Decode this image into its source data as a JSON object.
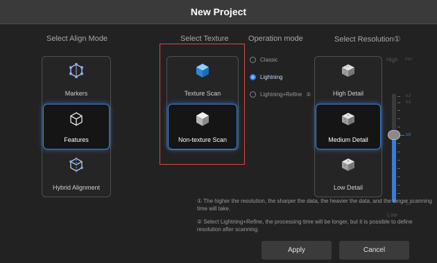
{
  "window": {
    "title": "New Project"
  },
  "align_mode": {
    "heading": "Select Align Mode",
    "options": [
      {
        "label": "Markers",
        "selected": false,
        "icon": "markers-icon"
      },
      {
        "label": "Features",
        "selected": true,
        "icon": "features-cube-icon"
      },
      {
        "label": "Hybrid Alignment",
        "selected": false,
        "icon": "hybrid-alignment-icon"
      }
    ]
  },
  "texture": {
    "heading": "Select Texture",
    "options": [
      {
        "label": "Texture Scan",
        "selected": false,
        "icon": "texture-cube-icon"
      },
      {
        "label": "Non-texture Scan",
        "selected": true,
        "icon": "non-texture-cube-icon"
      }
    ]
  },
  "operation_mode": {
    "heading": "Operation mode",
    "options": [
      {
        "label": "Classic",
        "selected": false
      },
      {
        "label": "Lightning",
        "selected": true
      },
      {
        "label": "Lightning+Refine",
        "selected": false,
        "marker": "②"
      }
    ]
  },
  "resolution": {
    "heading": "Select Resolution",
    "heading_marker": "①",
    "options": [
      {
        "label": "High Detail",
        "selected": false,
        "icon": "high-detail-icon"
      },
      {
        "label": "Medium Detail",
        "selected": true,
        "icon": "medium-detail-icon"
      },
      {
        "label": "Low Detail",
        "selected": false,
        "icon": "low-detail-icon"
      }
    ],
    "slider": {
      "high_label": "High",
      "unit": "mm",
      "low_label": "Low",
      "top_values": [
        "0.2",
        "0.3"
      ],
      "current_value": "1.0",
      "bottom_value": "2.0",
      "level_fraction": 0.62
    }
  },
  "notes": {
    "note1": "① The higher the resolution, the sharper the data, the heavier the data, and the longer scanning time will take.",
    "note2": "② Select Lightning+Refine, the processing time will be longer, but it is possible to define resolution after scanning."
  },
  "actions": {
    "apply": "Apply",
    "cancel": "Cancel"
  },
  "colors": {
    "accent": "#3b82d6",
    "highlight_box": "#d84a4a",
    "title_bar": "#3a3a3a"
  }
}
